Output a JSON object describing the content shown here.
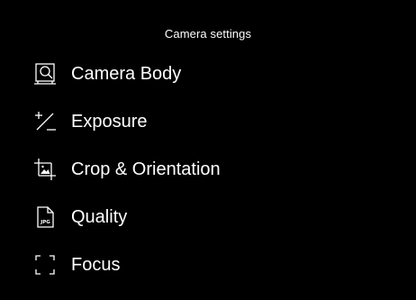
{
  "header": {
    "title": "Camera settings"
  },
  "menu": {
    "items": [
      {
        "label": "Camera Body",
        "icon": "camera-body-icon"
      },
      {
        "label": "Exposure",
        "icon": "exposure-icon"
      },
      {
        "label": "Crop & Orientation",
        "icon": "crop-icon"
      },
      {
        "label": "Quality",
        "icon": "jpg-file-icon",
        "icon_text": "JPG"
      },
      {
        "label": "Focus",
        "icon": "focus-frame-icon"
      }
    ]
  },
  "colors": {
    "background": "#000000",
    "foreground": "#ffffff"
  }
}
